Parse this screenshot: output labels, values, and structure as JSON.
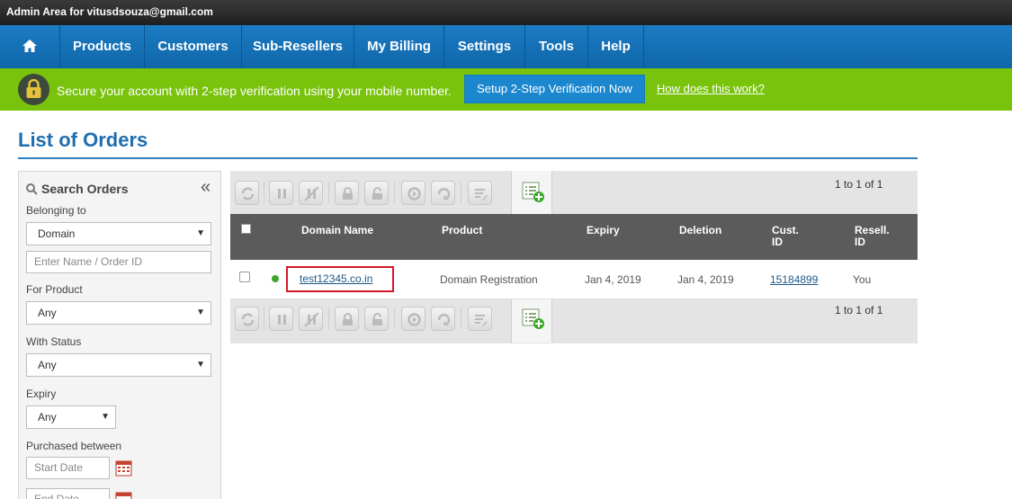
{
  "topbar": {
    "admin_text": "Admin Area for vitusdsouza@gmail.com"
  },
  "nav": {
    "home_icon": "home-icon",
    "items": [
      "Products",
      "Customers",
      "Sub-Resellers",
      "My Billing",
      "Settings",
      "Tools",
      "Help"
    ]
  },
  "banner": {
    "icon": "lock-icon",
    "text": "Secure your account with 2-step verification using your mobile number.",
    "button": "Setup 2-Step Verification Now",
    "link": "How does this work?",
    "color": "#79c30d"
  },
  "page": {
    "title": "List of Orders"
  },
  "sidebar": {
    "title": "Search Orders",
    "collapse": "«",
    "belonging_label": "Belonging to",
    "belonging_value": "Domain",
    "name_placeholder": "Enter Name / Order ID",
    "product_label": "For Product",
    "product_value": "Any",
    "status_label": "With Status",
    "status_value": "Any",
    "expiry_label": "Expiry",
    "expiry_value": "Any",
    "purchased_label": "Purchased between",
    "start_placeholder": "Start Date",
    "end_placeholder": "End Date"
  },
  "grid": {
    "pager_top": "1 to 1 of 1",
    "pager_bottom": "1 to 1 of 1",
    "columns": [
      "Domain Name",
      "Product",
      "Expiry",
      "Deletion",
      "Cust.",
      "ID",
      "Resell.",
      "ID"
    ],
    "rows": [
      {
        "status_color": "#3aa82a",
        "domain": "test12345.co.in",
        "product": "Domain Registration",
        "expiry": "Jan 4, 2019",
        "deletion": "Jan 4, 2019",
        "cust_id": "15184899",
        "resell_id": "You"
      }
    ]
  }
}
